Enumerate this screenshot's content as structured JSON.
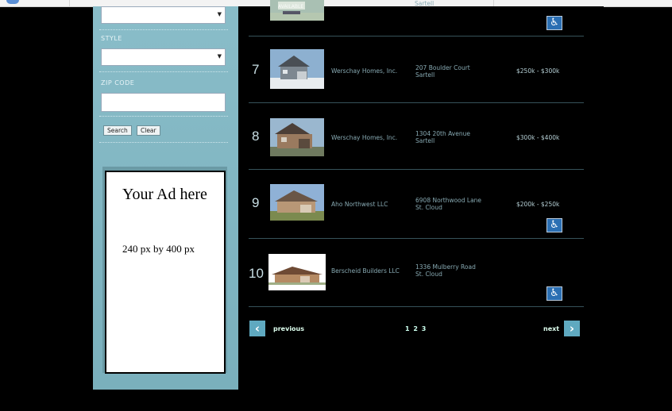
{
  "sidebar": {
    "style_label": "STYLE",
    "zip_label": "ZIP CODE",
    "zip_value": "",
    "search_label": "Search",
    "clear_label": "Clear",
    "ad_title": "Your Ad here",
    "ad_size": "240 px by 400 px"
  },
  "listing_top": {
    "badge": "AVAILABLE",
    "addr": "Sartell"
  },
  "listings": [
    {
      "num": "7",
      "builder": "Werschay Homes, Inc.",
      "addr1": "207 Boulder Court",
      "addr2": "Sartell",
      "price": "$250k - $300k"
    },
    {
      "num": "8",
      "builder": "Werschay Homes, Inc.",
      "addr1": "1304 20th Avenue",
      "addr2": "Sartell",
      "price": "$300k - $400k"
    },
    {
      "num": "9",
      "builder": "Aho Northwest LLC",
      "addr1": "6908 Northwood Lane",
      "addr2": "St. Cloud",
      "price": "$200k - $250k"
    },
    {
      "num": "10",
      "builder": "Berscheid Builders LLC",
      "addr1": "1336 Mulberry Road",
      "addr2": "St. Cloud",
      "price": ""
    }
  ],
  "pager": {
    "previous": "previous",
    "pages": "1 2 3",
    "next": "next"
  },
  "icons": {
    "accessibility": "wheelchair-icon",
    "prev_arrow": "chevron-left-icon",
    "next_arrow": "chevron-right-icon"
  },
  "colors": {
    "sidebar": "#7fb7c4",
    "accent": "#5fa9c0",
    "access_blue": "#2b6fb3"
  }
}
